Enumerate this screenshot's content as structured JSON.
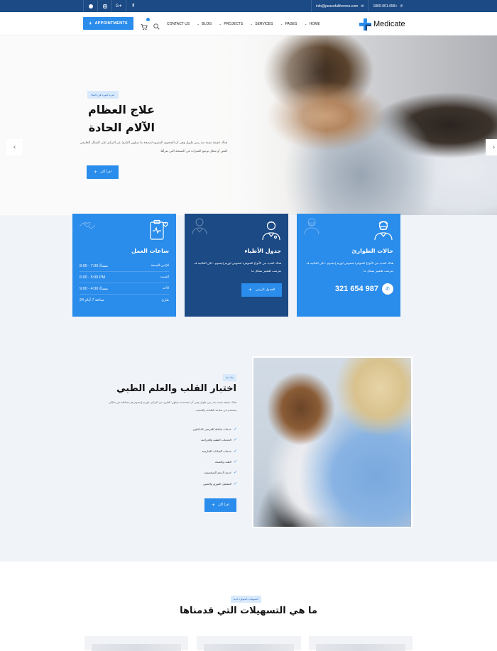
{
  "topbar": {
    "social": [
      {
        "icon": "dribbble-icon"
      },
      {
        "icon": "instagram-icon"
      },
      {
        "icon": "google-plus-icon",
        "glyph": "G+"
      },
      {
        "icon": "facebook-icon",
        "glyph": "f"
      }
    ],
    "email": "info@peacefulthemes.com",
    "phone": "1800-001-658+"
  },
  "navbar": {
    "appointments_label": "APPOINTMENTS",
    "cart_count": "",
    "links": [
      {
        "label": "CONTACT US",
        "dropdown": false
      },
      {
        "label": "BLOG",
        "dropdown": true
      },
      {
        "label": "PROJECTS",
        "dropdown": true
      },
      {
        "label": "SERVICES",
        "dropdown": true
      },
      {
        "label": "PAGES",
        "dropdown": true
      },
      {
        "label": "HOME",
        "dropdown": true
      }
    ],
    "logo_text": "Medicate"
  },
  "hero": {
    "tag": "خبرة كبيرة في البناء",
    "title_line1": "علاج العظام",
    "title_line2": "الآلام الحادة",
    "description": "هناك حقيقة مثبتة منذ زمن طويل وهي أن المحتوى المقروء لصفحة ما سيلهي القارئ عن التركيز على الشكل الخارجي للنص أو شكل توضع الفقرات في الصفحة التي يقرأها.",
    "read_more": "اقرأ أكثر",
    "prev_arrow": "‹",
    "next_arrow": "›"
  },
  "cards": {
    "hours": {
      "title": "ساعات العمل",
      "rows": [
        {
          "day": "الإثنين-الجمعة",
          "time": "8:00 - 7:00 مساءً"
        },
        {
          "day": "السبت",
          "time": "6:00 - 5:00 PM"
        },
        {
          "day": "الأحد",
          "time": "9:00 - 4:00 مساءً"
        },
        {
          "day": "طارئ",
          "time": "24 ساعة 7 أيام"
        }
      ]
    },
    "doctors": {
      "title": "جدول الأطباء",
      "description": "هناك العديد من الأنواع المتوفرة لنصوص لوريم إيبسوم ، لكن الغالبية قد تعرضت للتغيير بشكل ما",
      "button": "الجدول الزمني"
    },
    "emergency": {
      "title": "حالات الطوارئ",
      "description": "هناك العديد من الأنواع المتوفرة لنصوص لوريم إيبسوم ، لكن الغالبية قد تعرضت للتغيير بشكل ما",
      "phone": "321 654 987"
    }
  },
  "about": {
    "tag": "ماذا عنا",
    "title": "اختبار القلب والعلم الطبي",
    "description": "هناك حقيقة مثبتة منذ زمن طويل وهي أن تستخدمه سيلهي القارئ عن التركيز. لوريم إيبسوم هو ببساطة نص شكلي يستخدم في صناعة الطباعة والتنضيد.",
    "checklist": [
      "خدمات شاملة للمرضى الداخليين",
      "الخدمات الطبية والجراحية",
      "خدمات العيادات الخارجية",
      "الطب والصحة",
      "خدمة الدعم المتخصصة",
      "التشغيل الفوري والتعيين"
    ],
    "read_more": "اقرأ أكثر"
  },
  "services": {
    "tag": "التسهيلات المتوفرة لدينا",
    "title": "ما هي التسهيلات التي قدمناها"
  },
  "colors": {
    "primary": "#2a8ceb",
    "dark": "#1b4a85",
    "section_bg": "#f0f3f8"
  }
}
